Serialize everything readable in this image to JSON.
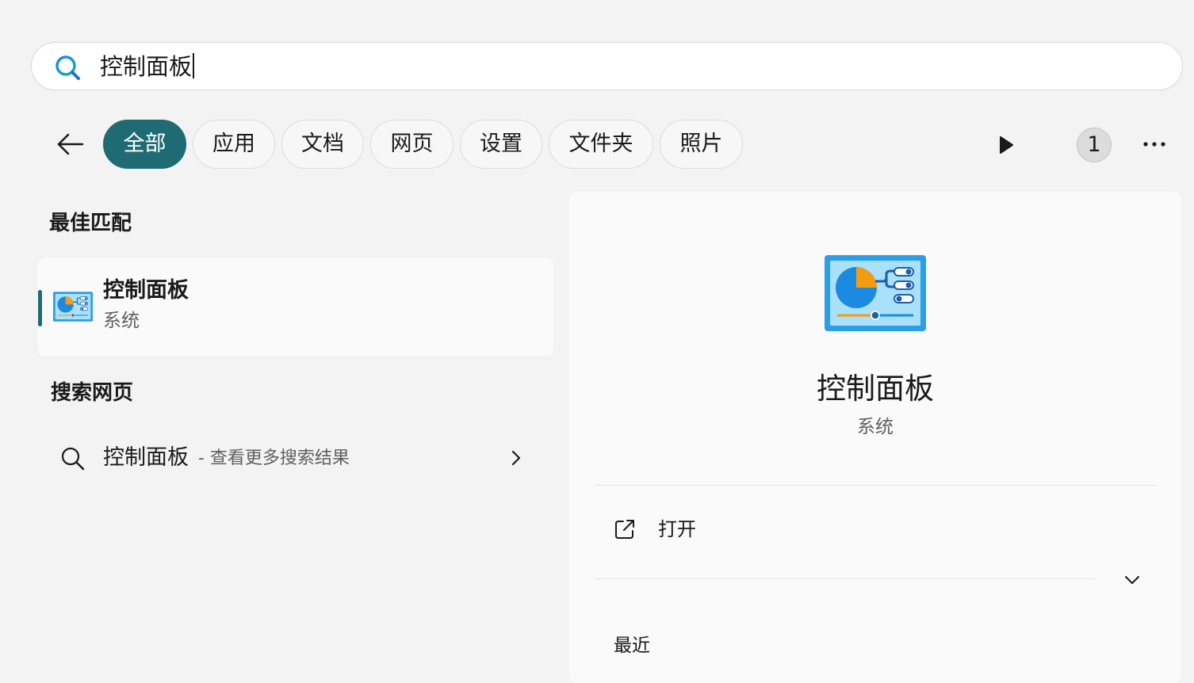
{
  "search": {
    "query": "控制面板"
  },
  "filters": [
    {
      "label": "全部",
      "active": true
    },
    {
      "label": "应用",
      "active": false
    },
    {
      "label": "文档",
      "active": false
    },
    {
      "label": "网页",
      "active": false
    },
    {
      "label": "设置",
      "active": false
    },
    {
      "label": "文件夹",
      "active": false
    },
    {
      "label": "照片",
      "active": false
    }
  ],
  "toolbar": {
    "badge_count": "1"
  },
  "best_match": {
    "heading": "最佳匹配",
    "title": "控制面板",
    "subtitle": "系统"
  },
  "web_search": {
    "heading": "搜索网页",
    "query": "控制面板",
    "hint": "- 查看更多搜索结果"
  },
  "details": {
    "title": "控制面板",
    "subtitle": "系统",
    "open_label": "打开",
    "recent_heading": "最近"
  },
  "colors": {
    "accent": "#1f6b74",
    "icon_blue": "#1e88e5",
    "icon_orange": "#f08c00"
  },
  "icons": [
    "search-icon",
    "back-arrow-icon",
    "play-icon",
    "more-icon",
    "control-panel-icon",
    "search-web-icon",
    "chevron-right-icon",
    "open-external-icon",
    "chevron-down-icon"
  ]
}
